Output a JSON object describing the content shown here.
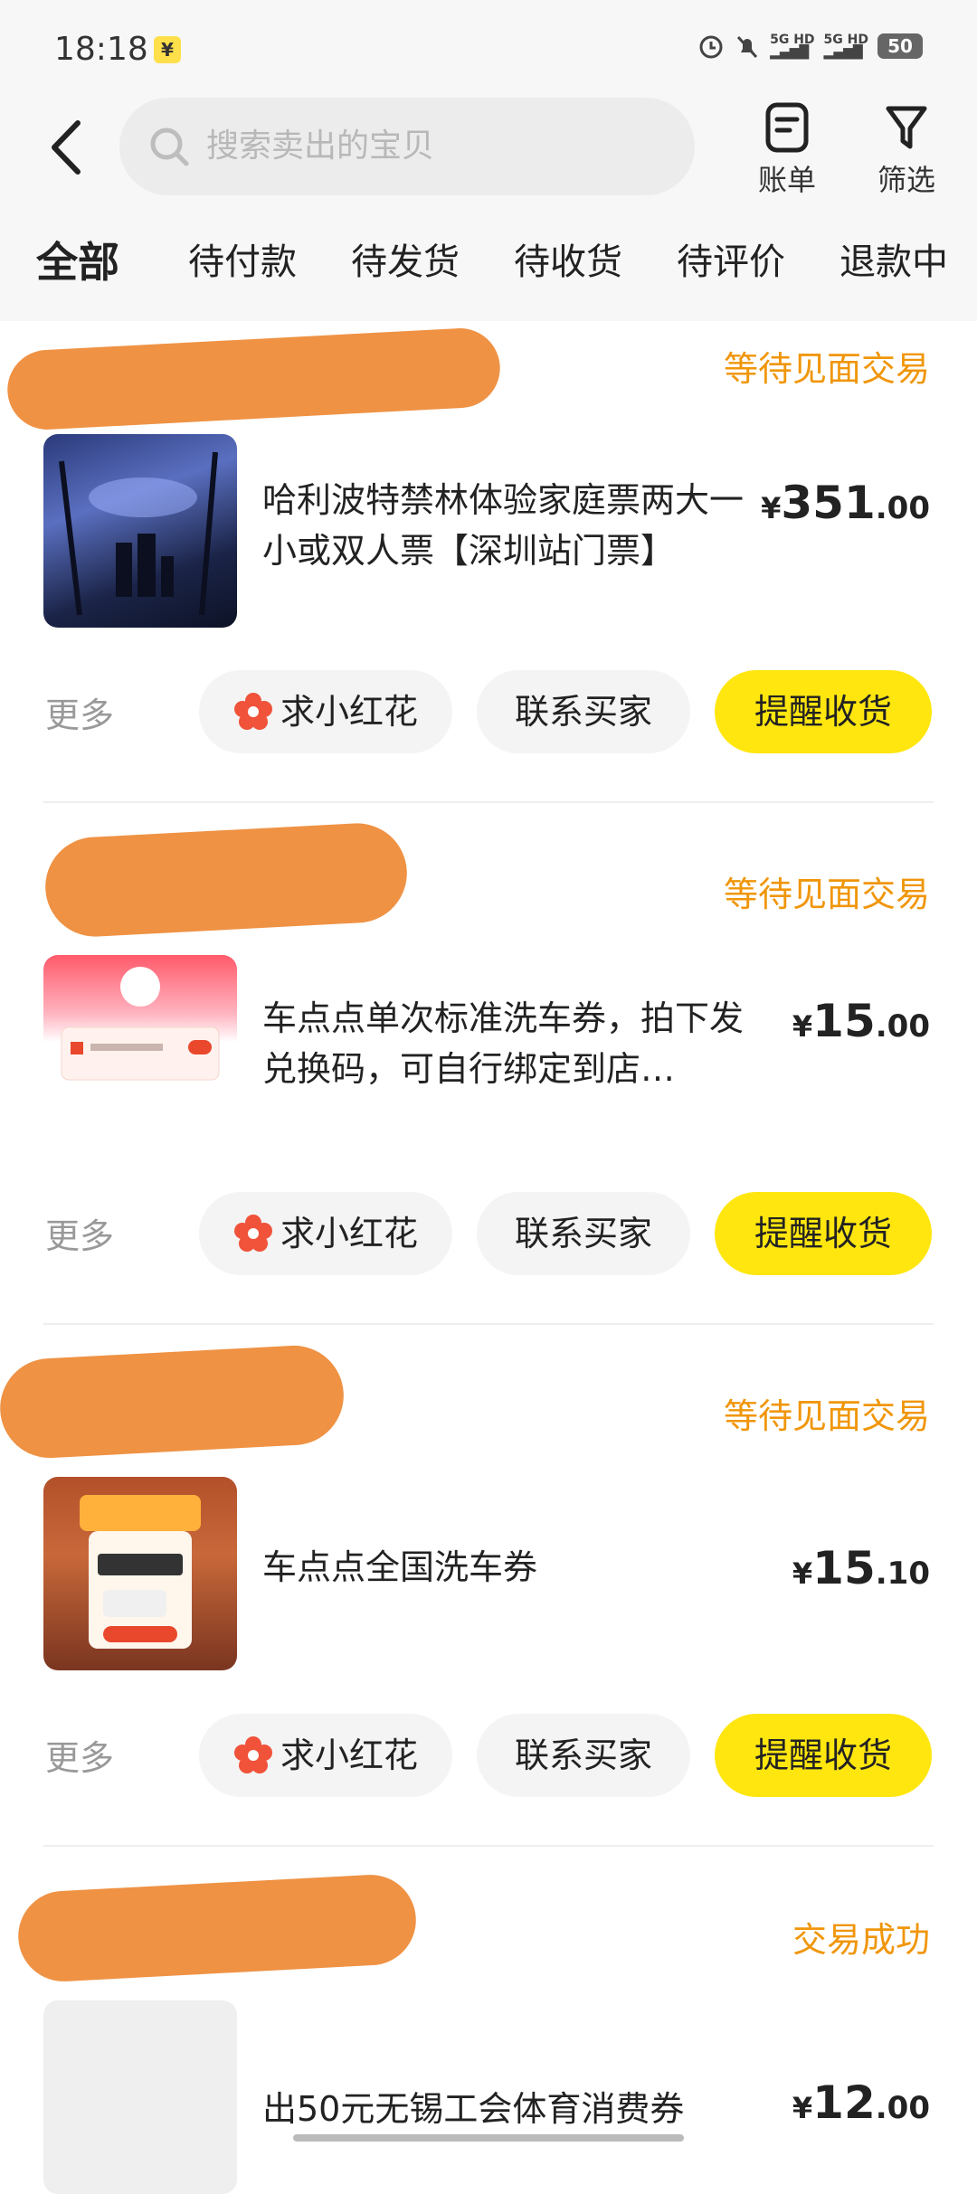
{
  "status_bar": {
    "time": "18:18",
    "yen_badge": "¥",
    "net1": "5G HD",
    "net2": "5G HD",
    "battery": "50"
  },
  "header": {
    "search_placeholder": "搜索卖出的宝贝",
    "bill_label": "账单",
    "filter_label": "筛选"
  },
  "tabs": [
    "全部",
    "待付款",
    "待发货",
    "待收货",
    "待评价",
    "退款中"
  ],
  "actions": {
    "more": "更多",
    "flower": "求小红花",
    "contact": "联系买家",
    "remind": "提醒收货"
  },
  "orders": [
    {
      "status": "等待见面交易",
      "title": "哈利波特禁林体验家庭票两大一小或双人票【深圳站门票】",
      "price_symbol": "¥",
      "price_int": "351",
      "price_dec": ".00"
    },
    {
      "status": "等待见面交易",
      "title": "车点点单次标准洗车券，拍下发兑换码，可自行绑定到店…",
      "price_symbol": "¥",
      "price_int": "15",
      "price_dec": ".00"
    },
    {
      "status": "等待见面交易",
      "title": "车点点全国洗车券",
      "price_symbol": "¥",
      "price_int": "15",
      "price_dec": ".10"
    },
    {
      "status": "交易成功",
      "title": "出50元无锡工会体育消费券",
      "price_symbol": "¥",
      "price_int": "12",
      "price_dec": ".00"
    }
  ],
  "colors": {
    "accent_yellow": "#ffe60f",
    "status_orange": "#f0960a",
    "redaction": "#ef9244"
  }
}
